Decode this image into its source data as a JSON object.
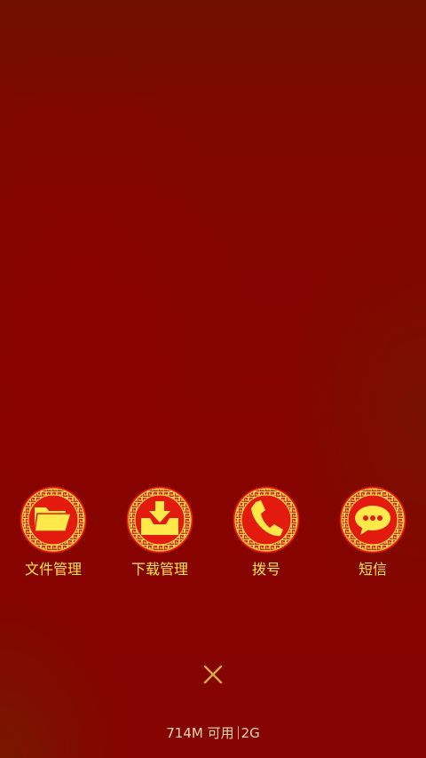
{
  "apps": [
    {
      "label": "文件管理",
      "icon": "folder-icon"
    },
    {
      "label": "下载管理",
      "icon": "download-icon"
    },
    {
      "label": "拨号",
      "icon": "phone-icon"
    },
    {
      "label": "短信",
      "icon": "message-icon"
    }
  ],
  "close_icon": "close-icon",
  "memory": {
    "available": "714M 可用",
    "total": "2G"
  },
  "colors": {
    "background": "#850300",
    "icon_red": "#e31b0f",
    "icon_gold": "#ffe94a",
    "label": "#ffe94a",
    "status_text": "#f3d9a6"
  }
}
